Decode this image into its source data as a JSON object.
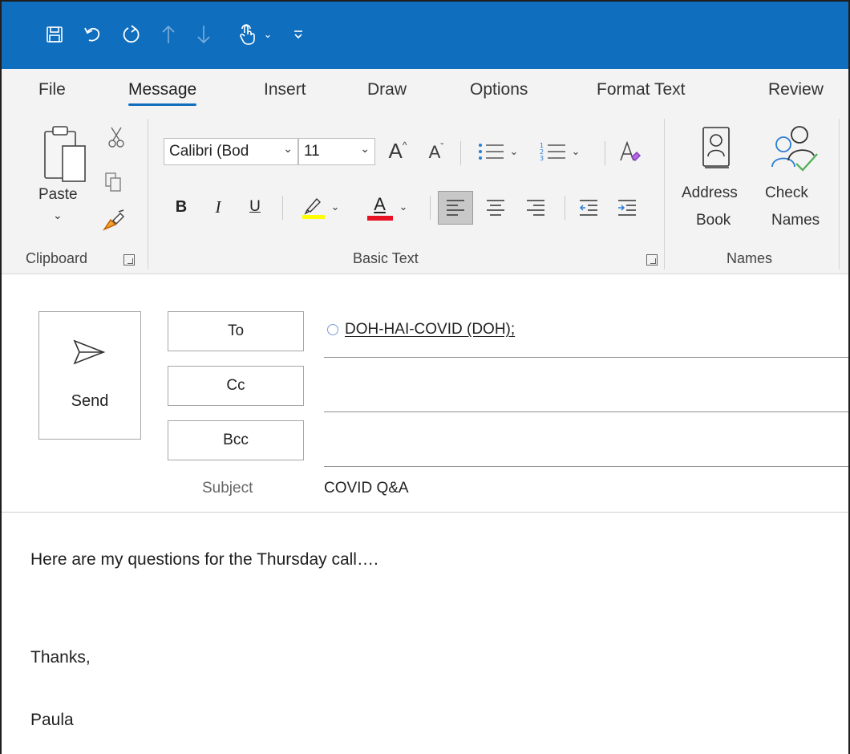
{
  "colors": {
    "accent": "#106ebe",
    "highlight_yellow": "#ffff00",
    "font_red": "#e81123"
  },
  "quick_access": [
    {
      "icon": "save-icon"
    },
    {
      "icon": "undo-icon"
    },
    {
      "icon": "redo-icon"
    },
    {
      "icon": "up-arrow-icon"
    },
    {
      "icon": "down-arrow-icon"
    },
    {
      "icon": "touch-mode-icon"
    },
    {
      "icon": "customize-qat-icon"
    }
  ],
  "tabs": [
    "File",
    "Message",
    "Insert",
    "Draw",
    "Options",
    "Format Text",
    "Review"
  ],
  "active_tab": "Message",
  "ribbon": {
    "clipboard": {
      "paste_label": "Paste",
      "group_label": "Clipboard"
    },
    "basic_text": {
      "font_name": "Calibri (Bod",
      "font_size": "11",
      "bold": "B",
      "italic": "I",
      "underline": "U",
      "font_color": "A",
      "grow_font": "A",
      "shrink_font": "A",
      "group_label": "Basic Text"
    },
    "names": {
      "address_book_line1": "Address",
      "address_book_line2": "Book",
      "check_names_line1": "Check",
      "check_names_line2": "Names",
      "group_label": "Names"
    }
  },
  "compose": {
    "send_label": "Send",
    "to_label": "To",
    "cc_label": "Cc",
    "bcc_label": "Bcc",
    "to_recipient": "DOH-HAI-COVID (DOH);",
    "subject_label": "Subject",
    "subject_value": "COVID Q&A"
  },
  "body": {
    "line1": "Here are my questions for the Thursday call….",
    "line2": "Thanks,",
    "line3": "Paula"
  }
}
